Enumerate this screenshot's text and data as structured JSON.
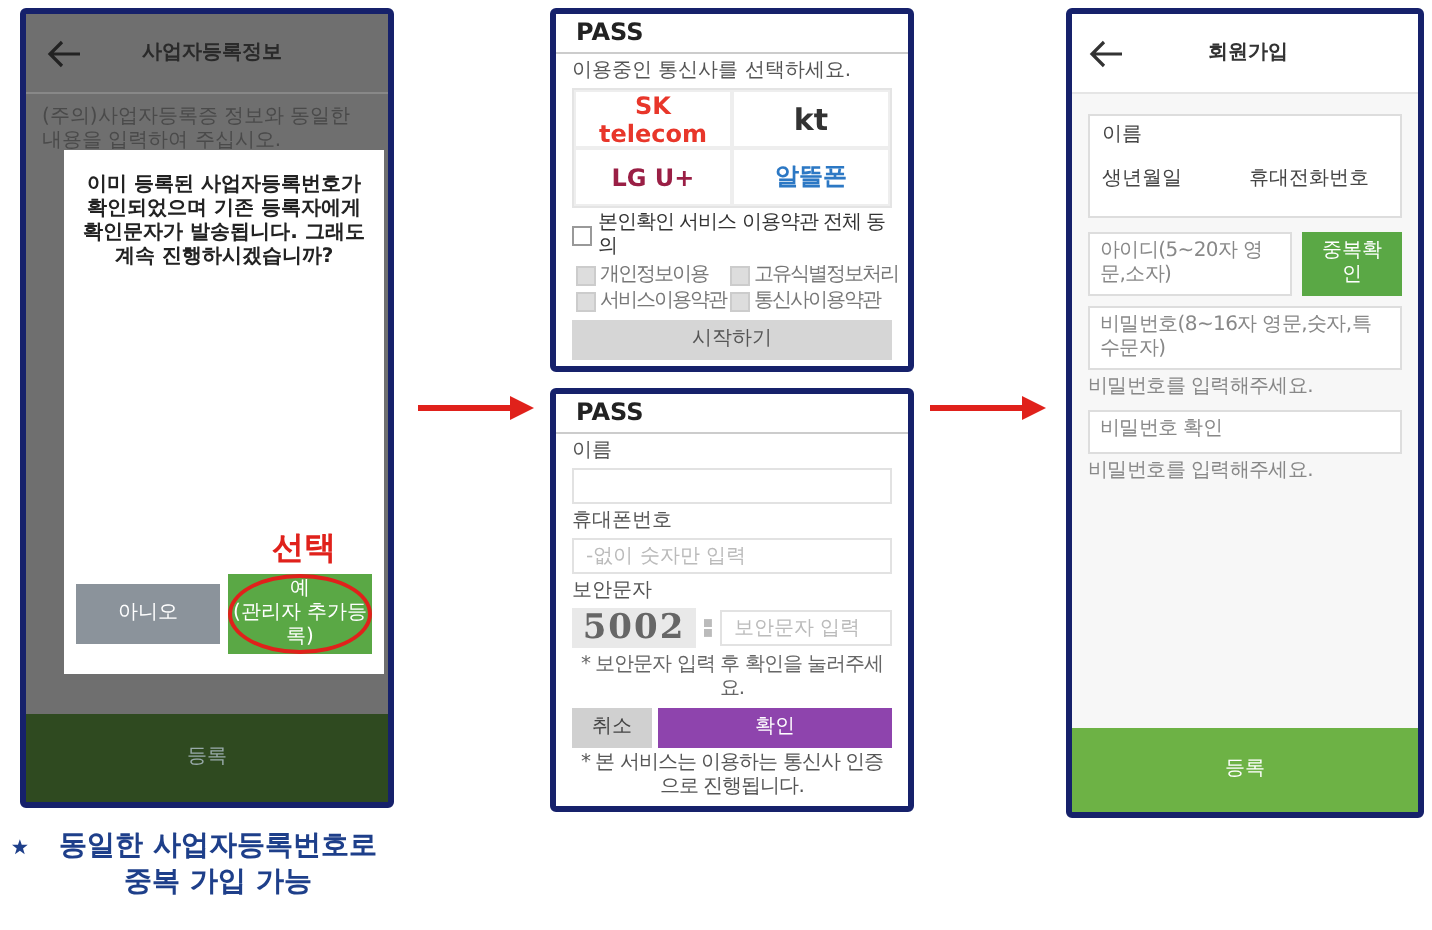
{
  "business_info_screen": {
    "title": "사업자등록정보",
    "notice": "(주의)사업자등록증 정보와 동일한 내용을 입력하여 주십시오.",
    "dialog": {
      "message": "이미 등록된 사업자등록번호가 확인되었으며 기존 등록자에게 확인문자가 발송됩니다. 그래도 계속 진행하시겠습니까?",
      "buttons": [
        {
          "label": "아니오",
          "kind": "cancel",
          "selected": false
        },
        {
          "label": "예\n(관리자 추가등록)",
          "kind": "confirm",
          "selected": true
        }
      ]
    },
    "callout": "선택",
    "submit": "등록"
  },
  "caption": "동일한 사업자등록번호로 중복 가입 가능",
  "carrier_screen": {
    "brand": "PASS",
    "prompt": "이용중인 통신사를 선택하세요.",
    "carriers": [
      {
        "name": "SK telecom",
        "kind": "skt"
      },
      {
        "name": "kt",
        "kind": "kt"
      },
      {
        "name": "LG U+",
        "kind": "lgu"
      },
      {
        "name": "알뜰폰",
        "kind": "mvno"
      }
    ],
    "agree_all": {
      "label": "본인확인 서비스 이용약관 전체 동의",
      "checked": false
    },
    "agreements": [
      {
        "label": "개인정보이용",
        "checked": false
      },
      {
        "label": "고유식별정보처리",
        "checked": false
      },
      {
        "label": "서비스이용약관",
        "checked": false
      },
      {
        "label": "통신사이용약관",
        "checked": false
      }
    ],
    "start_button": {
      "label": "시작하기",
      "disabled": true
    }
  },
  "verify_screen": {
    "brand": "PASS",
    "fields": [
      {
        "label": "이름"
      },
      {
        "label": "휴대폰번호",
        "placeholder": "-없이 숫자만 입력"
      }
    ],
    "captcha": {
      "label": "보안문자",
      "code": "5002",
      "placeholder": "보안문자 입력"
    },
    "note": "* 보안문자 입력 후 확인을 눌러주세요.",
    "buttons": [
      {
        "label": "취소",
        "kind": "cancel"
      },
      {
        "label": "확인",
        "kind": "confirm"
      }
    ],
    "footer": "* 본 서비스는 이용하는 통신사 인증으로 진행됩니다."
  },
  "signup_screen": {
    "title": "회원가입",
    "identity": [
      "이름",
      "생년월일",
      "휴대전화번호"
    ],
    "id_placeholder": "아이디(5~20자 영문,소자)",
    "check_button": "중복확인",
    "password_placeholder": "비밀번호(8~16자 영문,숫자,특수문자)",
    "password_hint": "비밀번호를 입력해주세요.",
    "confirm_placeholder": "비밀번호 확인",
    "confirm_hint": "비밀번호를 입력해주세요.",
    "submit": "등록"
  }
}
